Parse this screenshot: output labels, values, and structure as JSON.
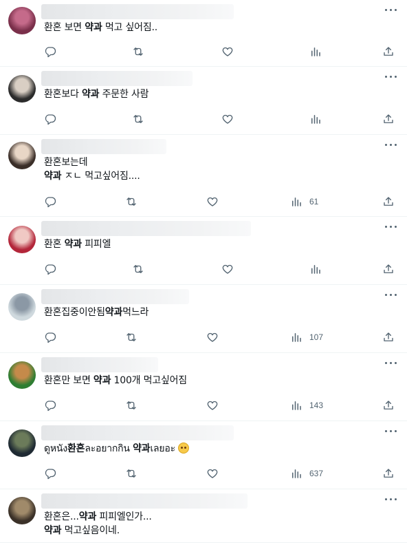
{
  "tweets": [
    {
      "parts": [
        [
          "환혼 보면 ",
          false
        ],
        [
          "약과",
          true
        ],
        [
          " 먹고 싶어짐..",
          false
        ]
      ],
      "line2": null,
      "views": "",
      "avatar": [
        "#7a2f4a",
        "#c56a8a"
      ]
    },
    {
      "parts": [
        [
          "환혼보다 ",
          false
        ],
        [
          "약과",
          true
        ],
        [
          " 주문한 사람",
          false
        ]
      ],
      "line2": null,
      "views": "",
      "avatar": [
        "#2b2b2b",
        "#d9cfc4"
      ]
    },
    {
      "parts": [
        [
          "환혼보는데",
          false
        ]
      ],
      "line2": [
        [
          "약과",
          true
        ],
        [
          " ㅈㄴ 먹고싶어짐....",
          false
        ]
      ],
      "views": "61",
      "avatar": [
        "#3a2e28",
        "#e8d6c6"
      ]
    },
    {
      "parts": [
        [
          "환혼 ",
          false
        ],
        [
          "약과",
          true
        ],
        [
          " 피피엘",
          false
        ]
      ],
      "line2": null,
      "views": "",
      "avatar": [
        "#b3263a",
        "#f0c9c4"
      ]
    },
    {
      "parts": [
        [
          "환혼집중이안됨",
          false
        ],
        [
          "약과",
          true
        ],
        [
          "먹느라",
          false
        ]
      ],
      "line2": null,
      "views": "107",
      "avatar": [
        "#cfd9de",
        "#8b98a5"
      ]
    },
    {
      "parts": [
        [
          "환혼만 보면 ",
          false
        ],
        [
          "약과",
          true
        ],
        [
          " 100개 먹고싶어짐",
          false
        ]
      ],
      "line2": null,
      "views": "143",
      "avatar": [
        "#2e7d32",
        "#c58a4a"
      ]
    },
    {
      "parts": [
        [
          "ดูหนัง",
          false
        ],
        [
          "환혼",
          true
        ],
        [
          "ละอยากกิน ",
          false
        ],
        [
          "약과",
          true
        ],
        [
          "เลยอะ ",
          false
        ]
      ],
      "emoji": "face-holding-back-tears",
      "line2": null,
      "views": "637",
      "avatar": [
        "#1f2a33",
        "#6b7b5a"
      ]
    },
    {
      "parts": [
        [
          "환혼은...",
          false
        ],
        [
          "약과",
          true
        ],
        [
          " 피피엘인가...",
          false
        ]
      ],
      "line2": [
        [
          "약과",
          true
        ],
        [
          " 먹고싶음이네.",
          false
        ]
      ],
      "views": "",
      "avatar": [
        "#3b3128",
        "#a08a6a"
      ]
    }
  ],
  "icons": [
    "reply-icon",
    "retweet-icon",
    "like-icon",
    "views-icon",
    "share-icon",
    "more-icon"
  ],
  "colors": {
    "icon": "#536471",
    "divider": "#eff3f4",
    "text": "#0f1419"
  }
}
